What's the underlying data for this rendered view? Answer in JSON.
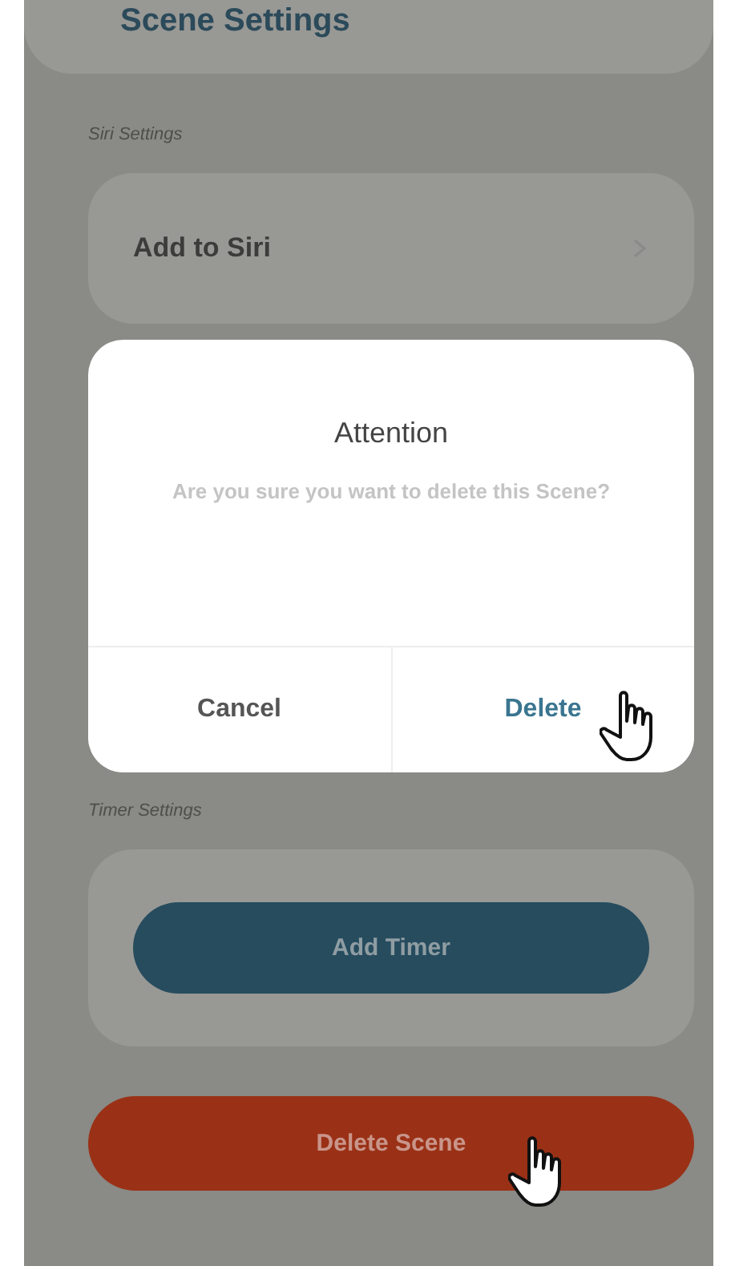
{
  "header": {
    "title": "Scene Settings"
  },
  "sections": [
    {
      "label": "Siri Settings",
      "items": [
        {
          "kind": "row",
          "label": "Add to Siri"
        }
      ]
    },
    {
      "label": "Timer Settings",
      "items": [
        {
          "kind": "button",
          "label": "Add Timer"
        }
      ]
    }
  ],
  "delete_button": {
    "label": "Delete Scene"
  },
  "dialog": {
    "title": "Attention",
    "message": "Are you sure you want to delete this Scene?",
    "buttons": [
      {
        "kind": "cancel",
        "label": "Cancel"
      },
      {
        "kind": "confirm",
        "label": "Delete"
      }
    ]
  }
}
